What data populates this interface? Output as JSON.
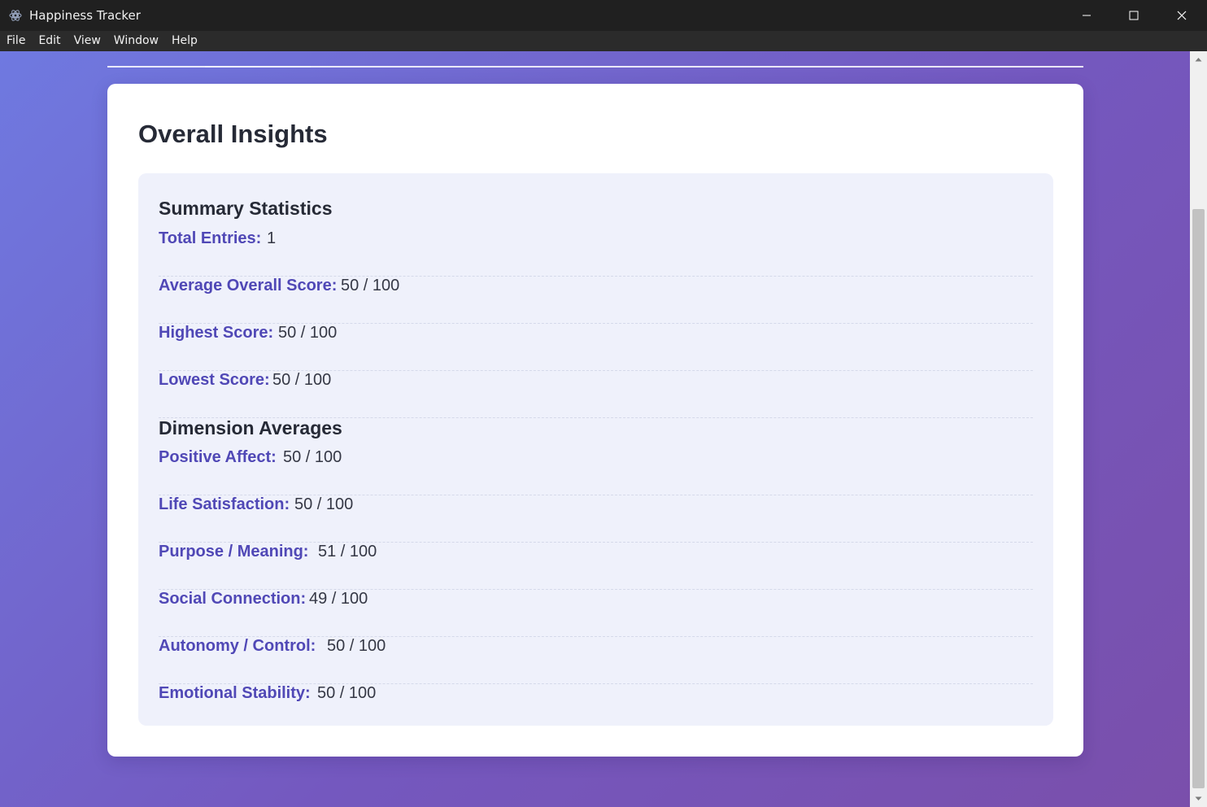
{
  "window": {
    "title": "Happiness Tracker",
    "icon": "electron-app-icon"
  },
  "menu": {
    "items": [
      "File",
      "Edit",
      "View",
      "Window",
      "Help"
    ]
  },
  "insights": {
    "title": "Overall Insights",
    "summary": {
      "heading": "Summary Statistics",
      "rows": [
        {
          "label": "Total Entries:",
          "value": "1"
        },
        {
          "label": "Average Overall Score:",
          "value": "50 / 100"
        },
        {
          "label": "Highest Score:",
          "value": "50 / 100"
        },
        {
          "label": "Lowest Score:",
          "value": "50 / 100"
        }
      ]
    },
    "dimensions": {
      "heading": "Dimension Averages",
      "rows": [
        {
          "label": "Positive Affect:",
          "value": "50 / 100"
        },
        {
          "label": "Life Satisfaction:",
          "value": "50 / 100"
        },
        {
          "label": "Purpose / Meaning:",
          "value": "51 / 100"
        },
        {
          "label": "Social Connection:",
          "value": "49 / 100"
        },
        {
          "label": "Autonomy / Control:",
          "value": "50 / 100"
        },
        {
          "label": "Emotional Stability:",
          "value": "50 / 100"
        }
      ]
    }
  },
  "colors": {
    "accent_label": "#5048b6",
    "background_start": "#6f79e0",
    "background_end": "#7a4fab"
  }
}
